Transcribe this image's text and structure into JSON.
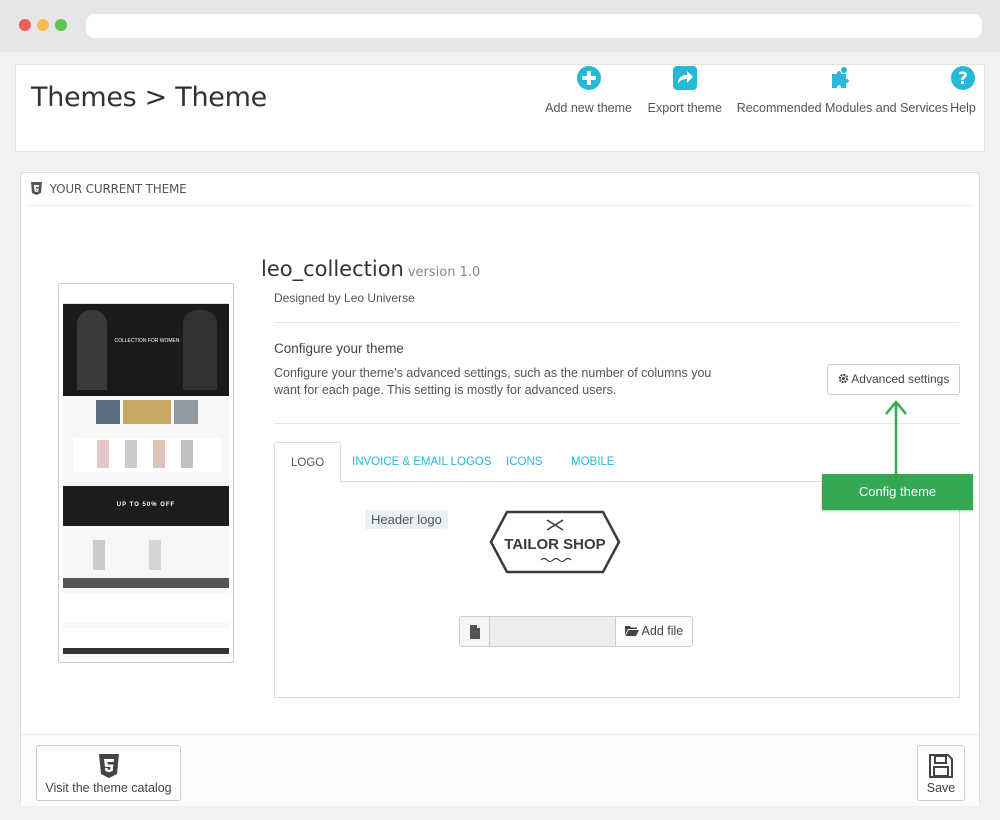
{
  "header": {
    "title": "Themes > Theme",
    "toolbar": [
      {
        "label": "Add new theme",
        "icon": "plus-circle-icon"
      },
      {
        "label": "Export theme",
        "icon": "share-icon"
      },
      {
        "label": "Recommended Modules and Services",
        "icon": "puzzle-icon"
      },
      {
        "label": "Help",
        "icon": "help-icon"
      }
    ]
  },
  "panel": {
    "heading": "YOUR CURRENT THEME",
    "theme_name": "leo_collection",
    "version": "version 1.0",
    "designer": "Designed by Leo Universe",
    "configure_title": "Configure your theme",
    "configure_desc": "Configure your theme's advanced settings, such as the number of columns you want for each page. This setting is mostly for advanced users.",
    "advanced_button": "Advanced settings",
    "tabs": [
      {
        "label": "LOGO",
        "active": true
      },
      {
        "label": "INVOICE & EMAIL LOGOS",
        "active": false
      },
      {
        "label": "ICONS",
        "active": false
      },
      {
        "label": "MOBILE",
        "active": false
      }
    ],
    "logo_label": "Header logo",
    "logo_text": "TAILOR SHOP",
    "file_input_value": "",
    "add_file_button": "Add file",
    "thumbnail": {
      "hero_text": "COLLECTION FOR WOMEN",
      "promo_text": "UP TO 50% OFF"
    }
  },
  "footer": {
    "catalog_button": "Visit the theme catalog",
    "save_button": "Save"
  },
  "annotation": {
    "label": "Config theme"
  },
  "colors": {
    "accent": "#25b9d7",
    "annotation_green": "#34a853",
    "title_text": "#333333"
  }
}
